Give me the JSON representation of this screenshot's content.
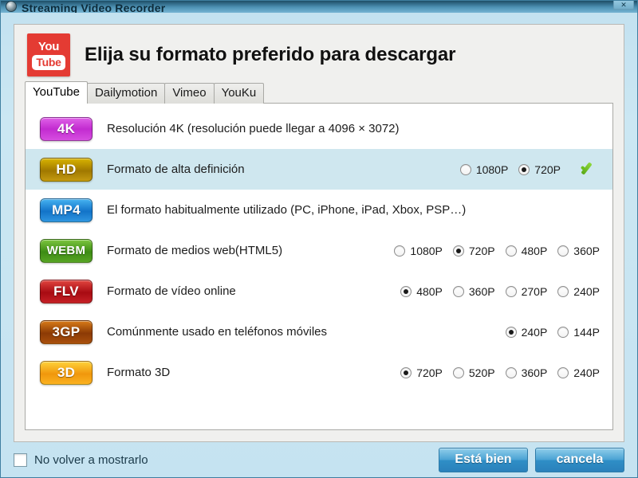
{
  "window": {
    "title": "Streaming Video Recorder",
    "close_label": "✕",
    "app_icon": "disc-icon"
  },
  "header": {
    "logo": {
      "top": "You",
      "bottom": "Tube",
      "name": "youtube-logo"
    },
    "title": "Elija su formato preferido para descargar"
  },
  "tabs": [
    {
      "label": "YouTube",
      "active": true
    },
    {
      "label": "Dailymotion",
      "active": false
    },
    {
      "label": "Vimeo",
      "active": false
    },
    {
      "label": "YouKu",
      "active": false
    }
  ],
  "formats": [
    {
      "badge": "4K",
      "badge_color": "#c22bd0",
      "description": "Resolución 4K (resolución puede llegar a 4096 × 3072)",
      "selected_row": false,
      "checkmark": false,
      "options": []
    },
    {
      "badge": "HD",
      "badge_color": "#a07800",
      "description": "Formato de alta definición",
      "selected_row": true,
      "checkmark": true,
      "options": [
        {
          "label": "1080P",
          "checked": false
        },
        {
          "label": "720P",
          "checked": true
        }
      ]
    },
    {
      "badge": "MP4",
      "badge_color": "#1273c8",
      "description": "El formato habitualmente utilizado (PC, iPhone, iPad, Xbox, PSP…)",
      "selected_row": false,
      "checkmark": false,
      "options": []
    },
    {
      "badge": "WEBM",
      "badge_color": "#3d8c14",
      "description": "Formato de medios web(HTML5)",
      "selected_row": false,
      "checkmark": false,
      "options": [
        {
          "label": "1080P",
          "checked": false
        },
        {
          "label": "720P",
          "checked": true
        },
        {
          "label": "480P",
          "checked": false
        },
        {
          "label": "360P",
          "checked": false
        }
      ]
    },
    {
      "badge": "FLV",
      "badge_color": "#a80b12",
      "description": "Formato de vídeo online",
      "selected_row": false,
      "checkmark": false,
      "options": [
        {
          "label": "480P",
          "checked": true
        },
        {
          "label": "360P",
          "checked": false
        },
        {
          "label": "270P",
          "checked": false
        },
        {
          "label": "240P",
          "checked": false
        }
      ]
    },
    {
      "badge": "3GP",
      "badge_color": "#8c3a05",
      "description": "Comúnmente usado en teléfonos móviles",
      "selected_row": false,
      "checkmark": false,
      "options": [
        {
          "label": "240P",
          "checked": true
        },
        {
          "label": "144P",
          "checked": false
        }
      ]
    },
    {
      "badge": "3D",
      "badge_color": "#f0970c",
      "description": "Formato 3D",
      "selected_row": false,
      "checkmark": false,
      "options": [
        {
          "label": "720P",
          "checked": true
        },
        {
          "label": "520P",
          "checked": false
        },
        {
          "label": "360P",
          "checked": false
        },
        {
          "label": "240P",
          "checked": false
        }
      ]
    }
  ],
  "footer": {
    "dont_show_label": "No volver a mostrarlo",
    "dont_show_checked": false,
    "ok_label": "Está bien",
    "cancel_label": "cancela"
  },
  "colors": {
    "window_background": "#c6e3f1",
    "panel_background": "#f0f0ee",
    "list_background": "#ffffff",
    "selected_row": "#cfe7ef",
    "accent_button": "#2f8ec6",
    "checkmark_green": "#6cc01c",
    "youtube_red": "#e43b33"
  }
}
